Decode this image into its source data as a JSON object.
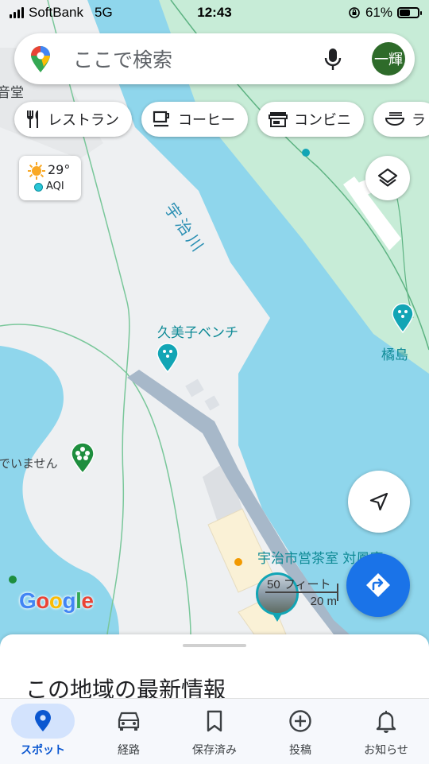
{
  "status_bar": {
    "carrier": "SoftBank",
    "network": "5G",
    "time": "12:43",
    "battery": "61%",
    "battery_level": 0.61
  },
  "search": {
    "placeholder": "ここで検索",
    "avatar_text": "一輝"
  },
  "chips": [
    {
      "label": "レストラン",
      "icon": "restaurant-icon"
    },
    {
      "label": "コーヒー",
      "icon": "coffee-icon"
    },
    {
      "label": "コンビニ",
      "icon": "store-icon"
    },
    {
      "label": "ラ",
      "icon": "ramen-icon"
    }
  ],
  "weather": {
    "temperature": "29°",
    "aqi_label": "AQI"
  },
  "map": {
    "labels": {
      "river": "宇治川",
      "bench": "久美子ベンチ",
      "island": "橘島",
      "otowa": "音堂",
      "closed": "でいません",
      "teahouse": "宇治市営茶室 対鳳庵"
    },
    "scale": {
      "imperial": "50 フィート",
      "metric": "20 m"
    },
    "logo": "Google",
    "colors": {
      "water": "#8fd6ec",
      "land": "#eef0f2",
      "park": "#c7ecd7",
      "road": "#a7b8c9",
      "poi_teal": "#12a5b5",
      "poi_green": "#1e8e3e",
      "accent": "#1a73e8"
    }
  },
  "sheet": {
    "title": "この地域の最新情報"
  },
  "bottom_nav": [
    {
      "label": "スポット",
      "icon": "location-pin-icon",
      "active": true
    },
    {
      "label": "経路",
      "icon": "car-icon",
      "active": false
    },
    {
      "label": "保存済み",
      "icon": "bookmark-icon",
      "active": false
    },
    {
      "label": "投稿",
      "icon": "add-circle-icon",
      "active": false
    },
    {
      "label": "お知らせ",
      "icon": "bell-icon",
      "active": false
    }
  ]
}
